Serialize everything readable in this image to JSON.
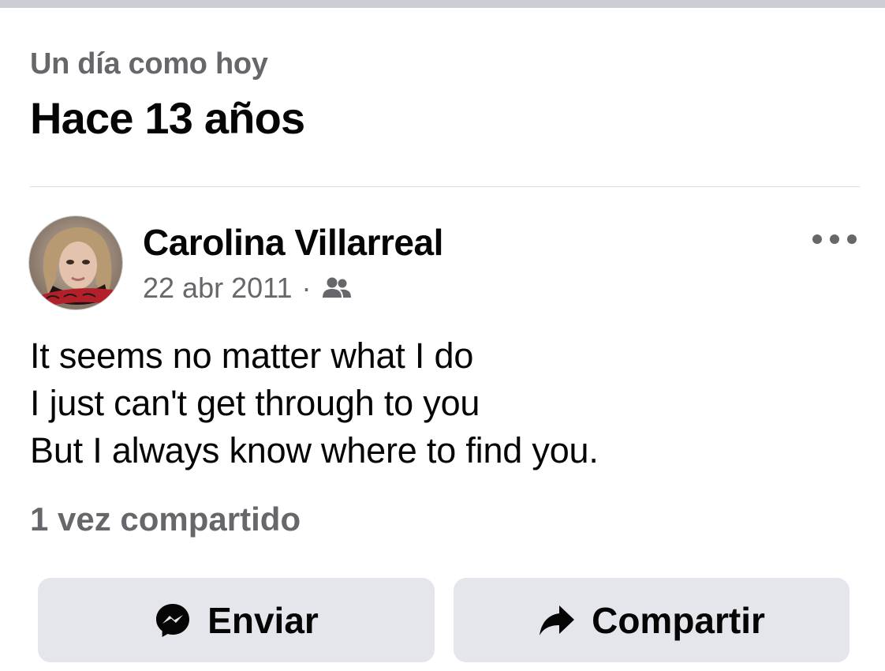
{
  "memory_header": {
    "subtitle": "Un día como hoy",
    "title": "Hace 13 años"
  },
  "post": {
    "author": "Carolina Villarreal",
    "date": "22 abr 2011",
    "separator": "·",
    "audience_icon": "friends-icon",
    "body_lines": [
      "It seems no matter what I do",
      "I just can't get through to you",
      "But I always know where to find you."
    ],
    "shares": "1 vez compartido"
  },
  "actions": {
    "send_label": "Enviar",
    "send_icon": "messenger-icon",
    "share_label": "Compartir",
    "share_icon": "share-arrow-icon"
  },
  "colors": {
    "secondary_text": "#65676b",
    "primary_text": "#050505",
    "button_bg": "#e4e6eb",
    "divider": "#dadde1",
    "top_bar": "#cbcdd2"
  }
}
